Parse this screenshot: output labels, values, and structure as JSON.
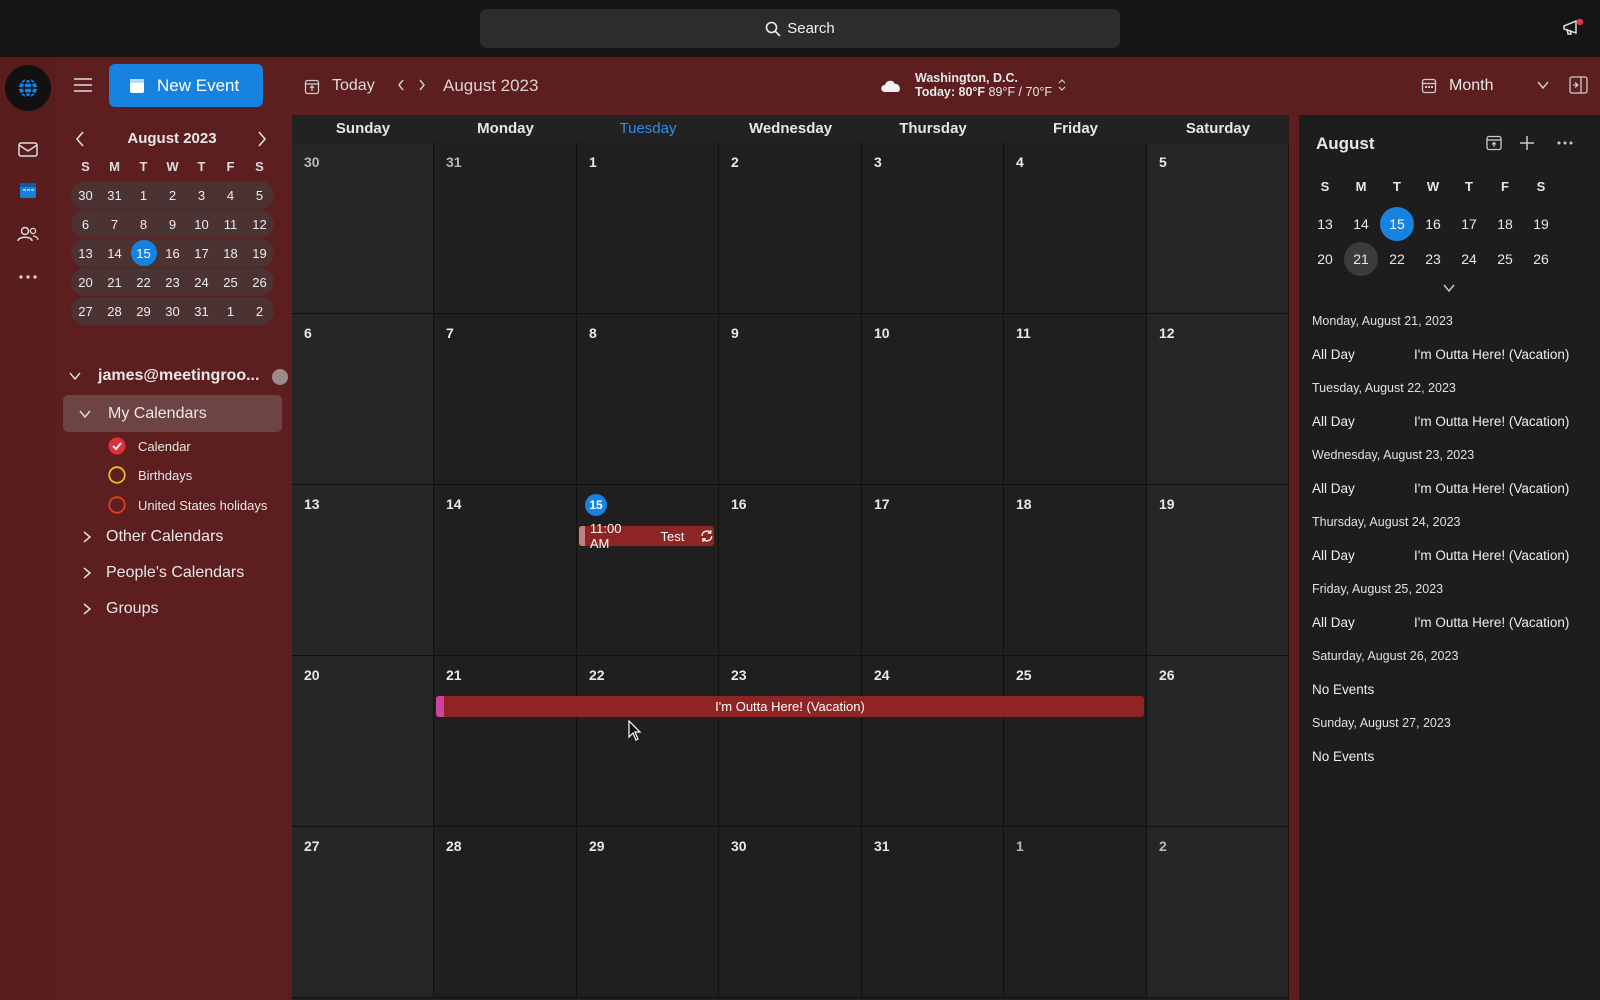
{
  "search": {
    "label": "Search"
  },
  "toolbar": {
    "new_event": "New Event",
    "today": "Today",
    "month_label": "August 2023",
    "weather_city": "Washington, D.C.",
    "weather_today": "Today: 80°F",
    "weather_range": "89°F / 70°F",
    "view": "Month"
  },
  "mini_calendar": {
    "title": "August 2023",
    "dow": [
      "S",
      "M",
      "T",
      "W",
      "T",
      "F",
      "S"
    ],
    "weeks": [
      [
        "30",
        "31",
        "1",
        "2",
        "3",
        "4",
        "5"
      ],
      [
        "6",
        "7",
        "8",
        "9",
        "10",
        "11",
        "12"
      ],
      [
        "13",
        "14",
        "15",
        "16",
        "17",
        "18",
        "19"
      ],
      [
        "20",
        "21",
        "22",
        "23",
        "24",
        "25",
        "26"
      ],
      [
        "27",
        "28",
        "29",
        "30",
        "31",
        "1",
        "2"
      ]
    ]
  },
  "sidebar": {
    "account": "james@meetingroo...",
    "my_calendars": "My Calendars",
    "calendars": [
      {
        "label": "Calendar",
        "color": "#e0303a",
        "checked": true
      },
      {
        "label": "Birthdays",
        "color": "#e8c21c",
        "checked": false
      },
      {
        "label": "United States holidays",
        "color": "#e0401e",
        "checked": false
      }
    ],
    "groups": [
      "Other Calendars",
      "People's Calendars",
      "Groups"
    ]
  },
  "month_grid": {
    "dow": [
      "Sunday",
      "Monday",
      "Tuesday",
      "Wednesday",
      "Thursday",
      "Friday",
      "Saturday"
    ],
    "weeks": [
      [
        "30",
        "31",
        "1",
        "2",
        "3",
        "4",
        "5"
      ],
      [
        "6",
        "7",
        "8",
        "9",
        "10",
        "11",
        "12"
      ],
      [
        "13",
        "14",
        "15",
        "16",
        "17",
        "18",
        "19"
      ],
      [
        "20",
        "21",
        "22",
        "23",
        "24",
        "25",
        "26"
      ],
      [
        "27",
        "28",
        "29",
        "30",
        "31",
        "1",
        "2"
      ]
    ],
    "event_test": {
      "time": "11:00 AM",
      "title": "Test"
    },
    "event_vacation": {
      "title": "I'm Outta Here! (Vacation)"
    }
  },
  "agenda": {
    "title": "August",
    "dow": [
      "S",
      "M",
      "T",
      "W",
      "T",
      "F",
      "S"
    ],
    "weeks": [
      [
        "13",
        "14",
        "15",
        "16",
        "17",
        "18",
        "19"
      ],
      [
        "20",
        "21",
        "22",
        "23",
        "24",
        "25",
        "26"
      ]
    ],
    "days": [
      {
        "date": "Monday, August 21, 2023",
        "time": "All Day",
        "summary": "I'm Outta Here! (Vacation)"
      },
      {
        "date": "Tuesday, August 22, 2023",
        "time": "All Day",
        "summary": "I'm Outta Here! (Vacation)"
      },
      {
        "date": "Wednesday, August 23, 2023",
        "time": "All Day",
        "summary": "I'm Outta Here! (Vacation)"
      },
      {
        "date": "Thursday, August 24, 2023",
        "time": "All Day",
        "summary": "I'm Outta Here! (Vacation)"
      },
      {
        "date": "Friday, August 25, 2023",
        "time": "All Day",
        "summary": "I'm Outta Here! (Vacation)"
      },
      {
        "date": "Saturday, August 26, 2023",
        "time": "No Events",
        "summary": ""
      },
      {
        "date": "Sunday, August 27, 2023",
        "time": "No Events",
        "summary": ""
      }
    ]
  },
  "colors": {
    "accent": "#1683e0",
    "event": "#8e2424",
    "chrome": "#5c1e1e"
  }
}
